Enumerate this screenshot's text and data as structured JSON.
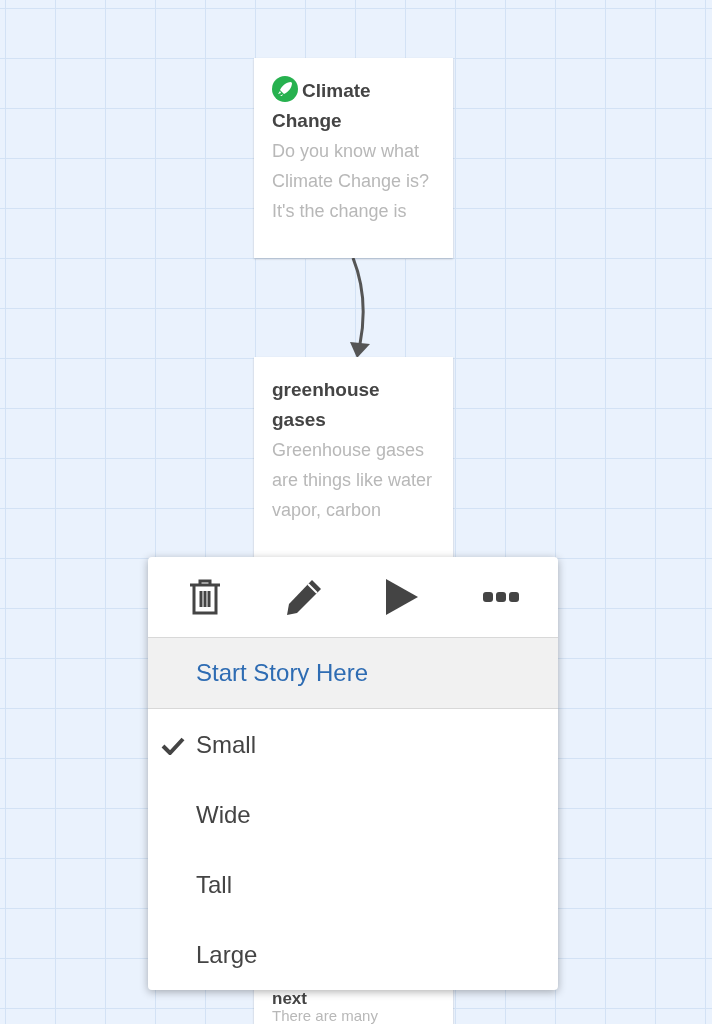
{
  "passages": [
    {
      "title": "Climate Change",
      "excerpt": "Do you know what Climate Change is? It's the change is",
      "start": true
    },
    {
      "title": "greenhouse gases",
      "excerpt": "Greenhouse gases are things like water vapor, carbon",
      "start": false
    },
    {
      "title": "next",
      "excerpt": "There are many",
      "start": false
    }
  ],
  "menu": {
    "start_item": "Start Story Here",
    "sizes": [
      {
        "label": "Small",
        "selected": true
      },
      {
        "label": "Wide",
        "selected": false
      },
      {
        "label": "Tall",
        "selected": false
      },
      {
        "label": "Large",
        "selected": false
      }
    ]
  }
}
